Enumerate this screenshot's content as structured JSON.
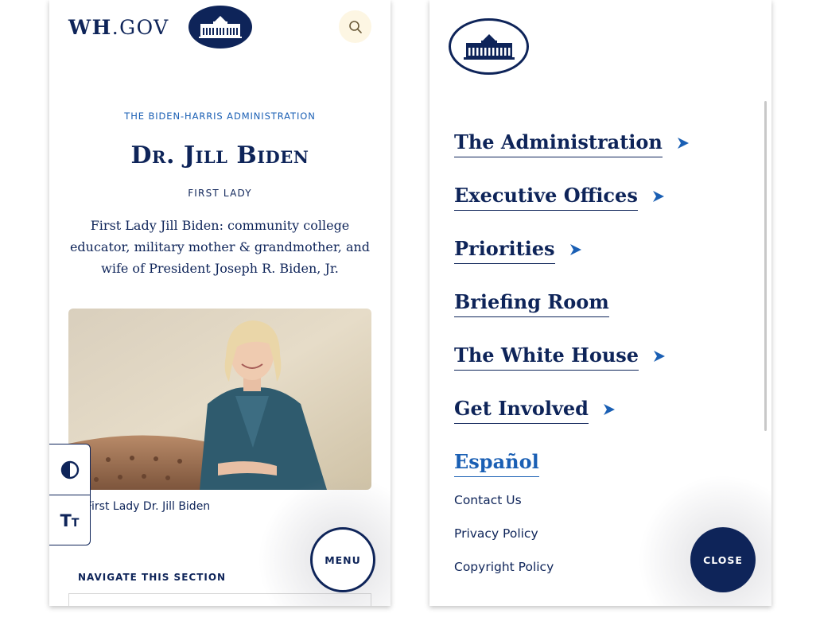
{
  "brand": {
    "wordmark_main": "WH",
    "wordmark_dot": ".GOV"
  },
  "hero": {
    "kicker": "THE BIDEN-HARRIS ADMINISTRATION",
    "title": "Dr. Jill Biden",
    "subtitle": "FIRST LADY",
    "intro": "First Lady Jill Biden: community college educator, military mother & grandmother, and wife of President Joseph R. Biden, Jr.",
    "photo_caption": "First Lady Dr. Jill Biden"
  },
  "navigate_section_label": "NAVIGATE THIS SECTION",
  "menu_button_label": "MENU",
  "close_button_label": "CLOSE",
  "icons": {
    "search": "search-icon",
    "contrast": "contrast-icon",
    "text_size": "text-size-icon",
    "seal": "white-house-seal",
    "arrow": "arrow-right-icon"
  },
  "text_size_glyph": {
    "big": "T",
    "small": "T"
  },
  "menu": {
    "items": [
      {
        "label": "The Administration",
        "has_submenu": true
      },
      {
        "label": "Executive Offices",
        "has_submenu": true
      },
      {
        "label": "Priorities",
        "has_submenu": true
      },
      {
        "label": "Briefing Room",
        "has_submenu": false
      },
      {
        "label": "The White House",
        "has_submenu": true
      },
      {
        "label": "Get Involved",
        "has_submenu": true
      }
    ],
    "language_link": "Español",
    "footer_links": [
      "Contact Us",
      "Privacy Policy",
      "Copyright Policy"
    ]
  },
  "colors": {
    "navy": "#0e2459",
    "link_blue": "#1a5fb4",
    "search_bg": "#fdf6e3"
  }
}
